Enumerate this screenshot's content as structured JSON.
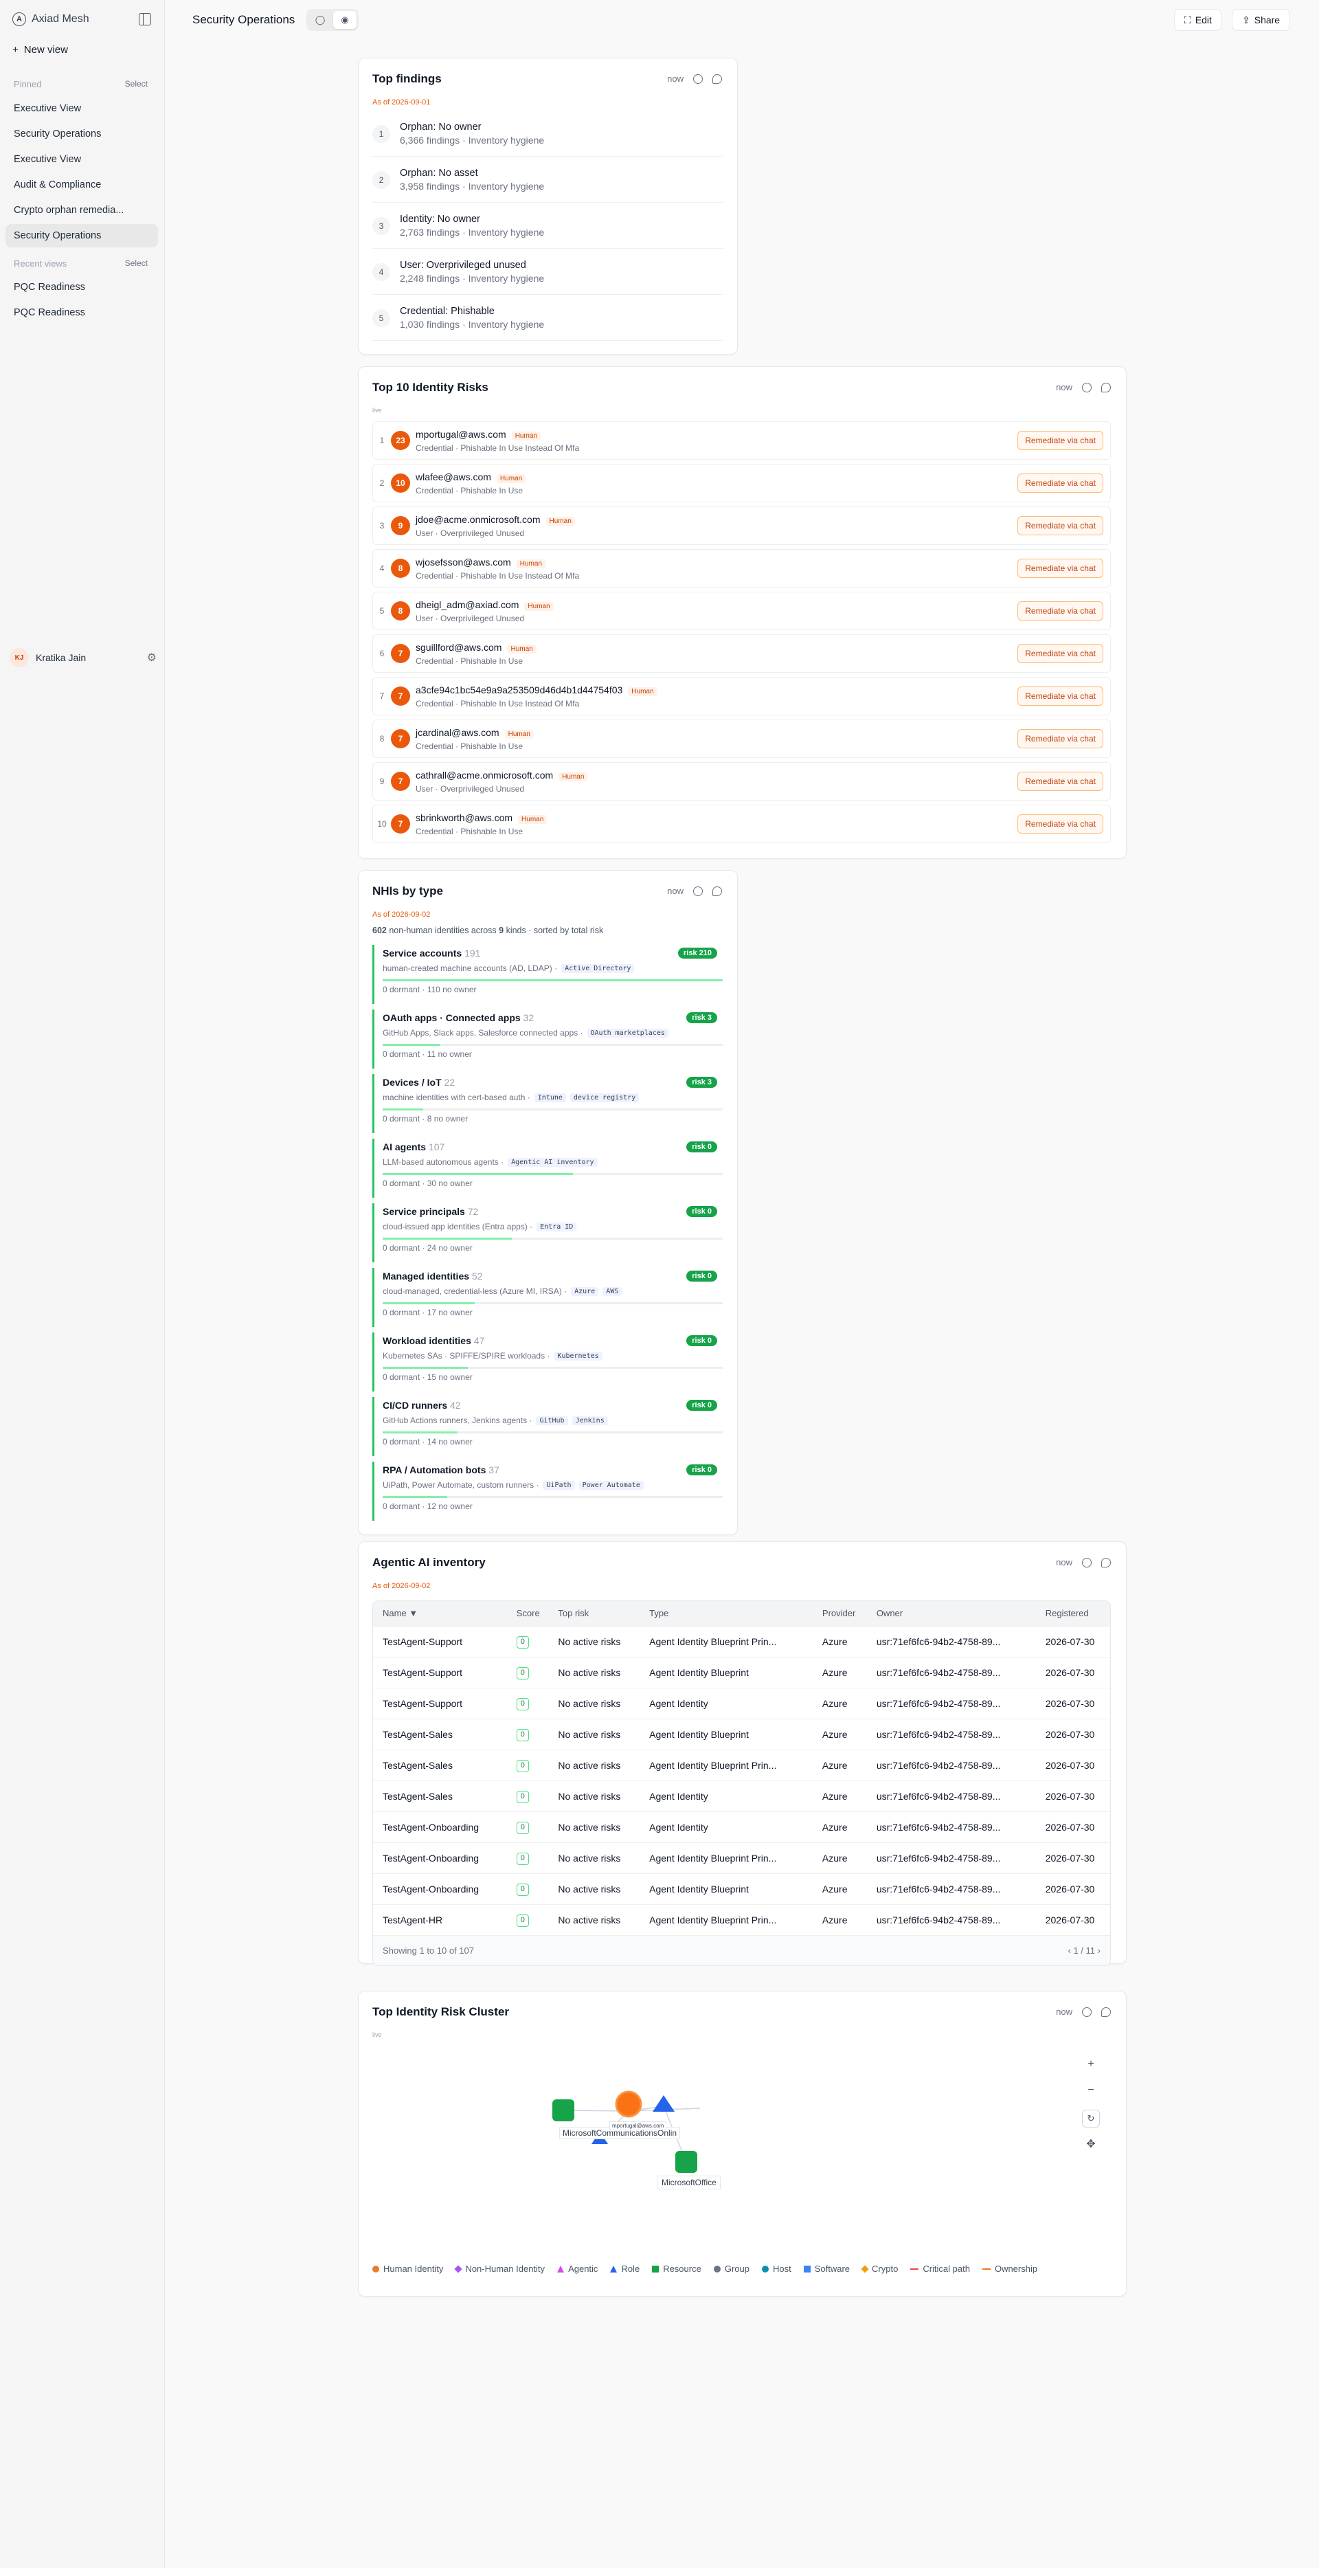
{
  "app": {
    "name": "Axiad Mesh",
    "page_title": "Security Operations",
    "new_view": "New view"
  },
  "sidebar": {
    "pinned_label": "Pinned",
    "select_label": "Select",
    "pinned": [
      "Executive View",
      "Security Operations",
      "Executive View",
      "Audit & Compliance",
      "Crypto orphan remedia...",
      "Security Operations"
    ],
    "recent_label": "Recent views",
    "recent": [
      "PQC Readiness",
      "PQC Readiness"
    ],
    "user_initials": "KJ",
    "user_name": "Kratika Jain"
  },
  "toolbar": {
    "edit": "Edit",
    "share": "Share"
  },
  "top_findings": {
    "title": "Top findings",
    "now": "now",
    "as_of": "As of 2026-09-01",
    "items": [
      {
        "rank": "1",
        "title": "Orphan: No owner",
        "sub": "6,366 findings · Inventory hygiene"
      },
      {
        "rank": "2",
        "title": "Orphan: No asset",
        "sub": "3,958 findings · Inventory hygiene"
      },
      {
        "rank": "3",
        "title": "Identity: No owner",
        "sub": "2,763 findings · Inventory hygiene"
      },
      {
        "rank": "4",
        "title": "User: Overprivileged unused",
        "sub": "2,248 findings · Inventory hygiene"
      },
      {
        "rank": "5",
        "title": "Credential: Phishable",
        "sub": "1,030 findings · Inventory hygiene"
      }
    ]
  },
  "identity_risks": {
    "title": "Top 10 Identity Risks",
    "now": "now",
    "live": "live",
    "button": "Remediate via chat",
    "rows": [
      {
        "rank": "1",
        "score": "23",
        "name": "mportugal@aws.com",
        "tag": "Human",
        "sub": "Credential · Phishable In Use Instead Of Mfa"
      },
      {
        "rank": "2",
        "score": "10",
        "name": "wlafee@aws.com",
        "tag": "Human",
        "sub": "Credential · Phishable In Use"
      },
      {
        "rank": "3",
        "score": "9",
        "name": "jdoe@acme.onmicrosoft.com",
        "tag": "Human",
        "sub": "User · Overprivileged Unused"
      },
      {
        "rank": "4",
        "score": "8",
        "name": "wjosefsson@aws.com",
        "tag": "Human",
        "sub": "Credential · Phishable In Use Instead Of Mfa"
      },
      {
        "rank": "5",
        "score": "8",
        "name": "dheigl_adm@axiad.com",
        "tag": "Human",
        "sub": "User · Overprivileged Unused"
      },
      {
        "rank": "6",
        "score": "7",
        "name": "sguillford@aws.com",
        "tag": "Human",
        "sub": "Credential · Phishable In Use"
      },
      {
        "rank": "7",
        "score": "7",
        "name": "a3cfe94c1bc54e9a9a253509d46d4b1d44754f03",
        "tag": "Human",
        "sub": "Credential · Phishable In Use Instead Of Mfa"
      },
      {
        "rank": "8",
        "score": "7",
        "name": "jcardinal@aws.com",
        "tag": "Human",
        "sub": "Credential · Phishable In Use"
      },
      {
        "rank": "9",
        "score": "7",
        "name": "cathrall@acme.onmicrosoft.com",
        "tag": "Human",
        "sub": "User · Overprivileged Unused"
      },
      {
        "rank": "10",
        "score": "7",
        "name": "sbrinkworth@aws.com",
        "tag": "Human",
        "sub": "Credential · Phishable In Use"
      }
    ]
  },
  "nhis": {
    "title": "NHIs by type",
    "now": "now",
    "as_of": "As of 2026-09-02",
    "summary_total": "602",
    "summary_mid": " non-human identities across ",
    "summary_kinds": "9",
    "summary_end": " kinds · sorted by total risk",
    "rows": [
      {
        "name": "Service accounts",
        "count": "191",
        "desc": "human-created machine accounts (AD, LDAP) ·",
        "tags": [
          "Active Directory"
        ],
        "dormant": "0 dormant",
        "noowner": "110 no owner",
        "risk": "risk 210",
        "fill": 1.0
      },
      {
        "name": "OAuth apps · Connected apps",
        "count": "32",
        "desc": "GitHub Apps, Slack apps, Salesforce connected apps ·",
        "tags": [
          "OAuth marketplaces"
        ],
        "dormant": "0 dormant",
        "noowner": "11 no owner",
        "risk": "risk 3",
        "fill": 0.17
      },
      {
        "name": "Devices / IoT",
        "count": "22",
        "desc": "machine identities with cert-based auth ·",
        "tags": [
          "Intune",
          "device registry"
        ],
        "dormant": "0 dormant",
        "noowner": "8 no owner",
        "risk": "risk 3",
        "fill": 0.12
      },
      {
        "name": "AI agents",
        "count": "107",
        "desc": "LLM-based autonomous agents ·",
        "tags": [
          "Agentic AI inventory"
        ],
        "dormant": "0 dormant",
        "noowner": "30 no owner",
        "risk": "risk 0",
        "fill": 0.56
      },
      {
        "name": "Service principals",
        "count": "72",
        "desc": "cloud-issued app identities (Entra apps) ·",
        "tags": [
          "Entra ID"
        ],
        "dormant": "0 dormant",
        "noowner": "24 no owner",
        "risk": "risk 0",
        "fill": 0.38
      },
      {
        "name": "Managed identities",
        "count": "52",
        "desc": "cloud-managed, credential-less (Azure MI, IRSA) ·",
        "tags": [
          "Azure",
          "AWS"
        ],
        "dormant": "0 dormant",
        "noowner": "17 no owner",
        "risk": "risk 0",
        "fill": 0.27
      },
      {
        "name": "Workload identities",
        "count": "47",
        "desc": "Kubernetes SAs · SPIFFE/SPIRE workloads ·",
        "tags": [
          "Kubernetes"
        ],
        "dormant": "0 dormant",
        "noowner": "15 no owner",
        "risk": "risk 0",
        "fill": 0.25
      },
      {
        "name": "CI/CD runners",
        "count": "42",
        "desc": "GitHub Actions runners, Jenkins agents ·",
        "tags": [
          "GitHub",
          "Jenkins"
        ],
        "dormant": "0 dormant",
        "noowner": "14 no owner",
        "risk": "risk 0",
        "fill": 0.22
      },
      {
        "name": "RPA / Automation bots",
        "count": "37",
        "desc": "UiPath, Power Automate, custom runners ·",
        "tags": [
          "UiPath",
          "Power Automate"
        ],
        "dormant": "0 dormant",
        "noowner": "12 no owner",
        "risk": "risk 0",
        "fill": 0.19
      }
    ]
  },
  "agentic": {
    "title": "Agentic AI inventory",
    "now": "now",
    "as_of": "As of 2026-09-02",
    "columns": [
      "Name ▼",
      "Score",
      "Top risk",
      "Type",
      "Provider",
      "Owner",
      "Registered"
    ],
    "rows": [
      [
        "TestAgent-Support",
        "0",
        "No active risks",
        "Agent Identity Blueprint Prin...",
        "Azure",
        "usr:71ef6fc6-94b2-4758-89...",
        "2026-07-30"
      ],
      [
        "TestAgent-Support",
        "0",
        "No active risks",
        "Agent Identity Blueprint",
        "Azure",
        "usr:71ef6fc6-94b2-4758-89...",
        "2026-07-30"
      ],
      [
        "TestAgent-Support",
        "0",
        "No active risks",
        "Agent Identity",
        "Azure",
        "usr:71ef6fc6-94b2-4758-89...",
        "2026-07-30"
      ],
      [
        "TestAgent-Sales",
        "0",
        "No active risks",
        "Agent Identity Blueprint",
        "Azure",
        "usr:71ef6fc6-94b2-4758-89...",
        "2026-07-30"
      ],
      [
        "TestAgent-Sales",
        "0",
        "No active risks",
        "Agent Identity Blueprint Prin...",
        "Azure",
        "usr:71ef6fc6-94b2-4758-89...",
        "2026-07-30"
      ],
      [
        "TestAgent-Sales",
        "0",
        "No active risks",
        "Agent Identity",
        "Azure",
        "usr:71ef6fc6-94b2-4758-89...",
        "2026-07-30"
      ],
      [
        "TestAgent-Onboarding",
        "0",
        "No active risks",
        "Agent Identity",
        "Azure",
        "usr:71ef6fc6-94b2-4758-89...",
        "2026-07-30"
      ],
      [
        "TestAgent-Onboarding",
        "0",
        "No active risks",
        "Agent Identity Blueprint Prin...",
        "Azure",
        "usr:71ef6fc6-94b2-4758-89...",
        "2026-07-30"
      ],
      [
        "TestAgent-Onboarding",
        "0",
        "No active risks",
        "Agent Identity Blueprint",
        "Azure",
        "usr:71ef6fc6-94b2-4758-89...",
        "2026-07-30"
      ],
      [
        "TestAgent-HR",
        "0",
        "No active risks",
        "Agent Identity Blueprint Prin...",
        "Azure",
        "usr:71ef6fc6-94b2-4758-89...",
        "2026-07-30"
      ]
    ],
    "footer": "Showing 1 to 10 of 107",
    "page": "1 / 11"
  },
  "cluster": {
    "title": "Top Identity Risk Cluster",
    "now": "now",
    "live": "live",
    "labels": {
      "ms_comm": "MicrosoftCommunicationsOnlin",
      "user": "mportugal@aws.com",
      "office": "MicrosoftOffice"
    },
    "legend": [
      {
        "label": "Human Identity",
        "color": "#ea7a2c",
        "shape": "circle"
      },
      {
        "label": "Non-Human Identity",
        "color": "#a855f7",
        "shape": "diamond"
      },
      {
        "label": "Agentic",
        "color": "#d946ef",
        "shape": "triangle"
      },
      {
        "label": "Role",
        "color": "#2563eb",
        "shape": "triangle"
      },
      {
        "label": "Resource",
        "color": "#16a34a",
        "shape": "square"
      },
      {
        "label": "Group",
        "color": "#6b7280",
        "shape": "circle"
      },
      {
        "label": "Host",
        "color": "#0891b2",
        "shape": "circle"
      },
      {
        "label": "Software",
        "color": "#3b82f6",
        "shape": "square"
      },
      {
        "label": "Crypto",
        "color": "#f59e0b",
        "shape": "diamond"
      },
      {
        "label": "Critical path",
        "color": "#ef4444",
        "shape": "line"
      },
      {
        "label": "Ownership",
        "color": "#f97316",
        "shape": "line"
      }
    ]
  }
}
